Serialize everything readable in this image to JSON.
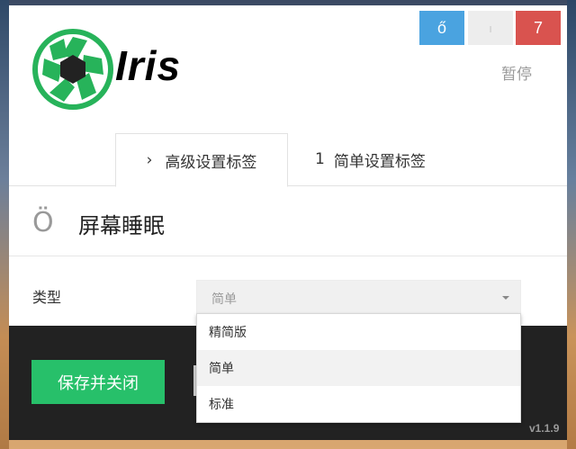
{
  "app": {
    "logo_text": "Iris",
    "version": "v1.1.9"
  },
  "top_buttons": [
    {
      "label": "ő",
      "color": "#4aa3e0"
    },
    {
      "label": "ı",
      "color": "#ededed"
    },
    {
      "label": "7",
      "color": "#d9534f"
    }
  ],
  "pause_label": "暂停",
  "tabs": [
    {
      "icon_text": "›",
      "label": "高级设置标签",
      "active": true
    },
    {
      "icon_text": "1",
      "label": "简单设置标签",
      "active": false
    }
  ],
  "section": {
    "icon_text": "Ö",
    "title": "屏幕睡眠"
  },
  "type_field": {
    "label": "类型",
    "selected": "简单",
    "options": [
      "精简版",
      "简单",
      "标准"
    ],
    "highlighted_option": "简单"
  },
  "footer": {
    "save_label": "保存并关闭",
    "accent": "#27c06a"
  },
  "icons": {
    "logo": "aperture-logo-icon",
    "caret": "caret-down-icon"
  }
}
